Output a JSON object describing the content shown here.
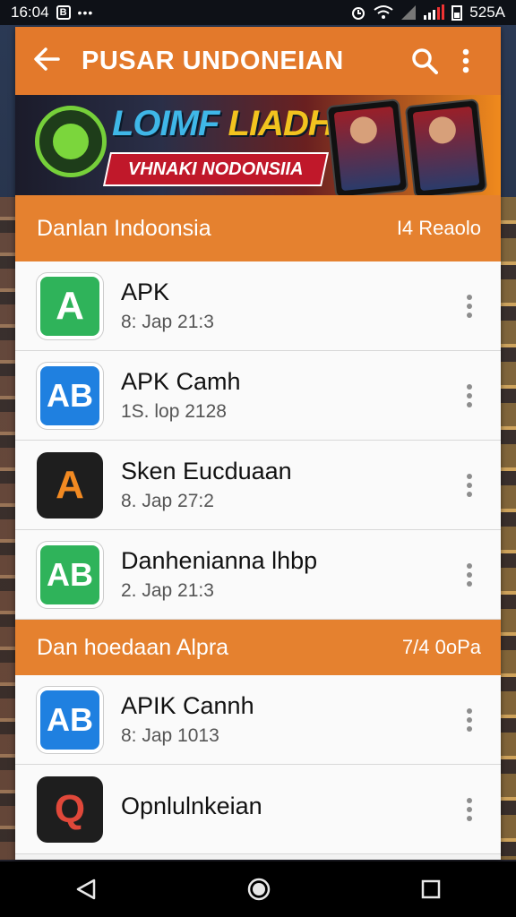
{
  "status_bar": {
    "time": "16:04",
    "notif_badge": "B",
    "dots": "•••",
    "battery": "525A"
  },
  "app_bar": {
    "title": "PUSAR UNDONEIAN"
  },
  "banner": {
    "headline_part1": "LOIMF ",
    "headline_part2": "LIADHIN",
    "subline": "VHNAKI NODONSIIA"
  },
  "sections": [
    {
      "title": "Danlan Indoonsia",
      "count": "I4 Reaolo",
      "items": [
        {
          "name": "APK",
          "date": "8: Jap 21:3",
          "icon_letter": "A",
          "icon_color": "#2fb35a"
        },
        {
          "name": "APK Camh",
          "date": "1S. lop 2128",
          "icon_letter": "AB",
          "icon_color": "#1f80e0"
        },
        {
          "name": "Sken Eucduaan",
          "date": "8. Jap 27:2",
          "icon_letter": "A",
          "icon_color": "#1e1e1e"
        },
        {
          "name": "Danhenianna lhbp",
          "date": "2. Jap 21:3",
          "icon_letter": "AB",
          "icon_color": "#2fb35a"
        }
      ]
    },
    {
      "title": "Dan hoedaan Alpra",
      "count": "7/4 0oPa",
      "items": [
        {
          "name": "APIK Cannh",
          "date": "8: Jap 1013",
          "icon_letter": "AB",
          "icon_color": "#1f80e0"
        },
        {
          "name": "Opnlulnkeian",
          "date": "",
          "icon_letter": "Q",
          "icon_color": "#1e1e1e"
        }
      ]
    }
  ],
  "icons": {
    "back": "arrow-left-icon",
    "search": "search-icon",
    "overflow": "more-vertical-icon",
    "nav_back": "triangle-back-icon",
    "nav_home": "circle-home-icon",
    "nav_recents": "square-recents-icon"
  },
  "colors": {
    "accent": "#e3792b",
    "section": "#e5812f"
  }
}
